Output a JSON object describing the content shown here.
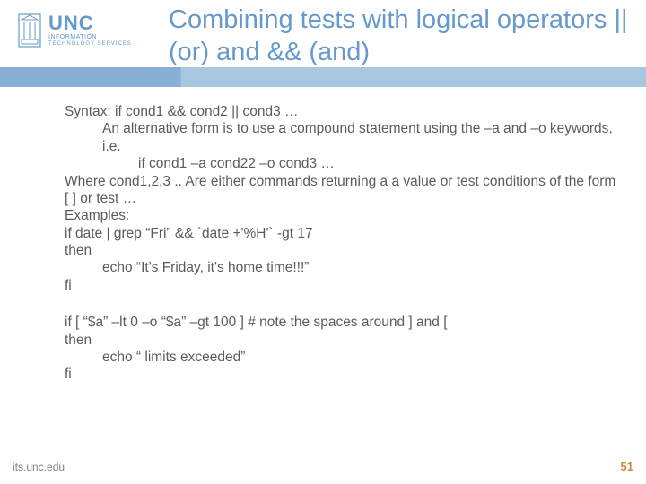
{
  "logo": {
    "unc": "UNC",
    "line1": "INFORMATION",
    "line2": "TECHNOLOGY SERVICES"
  },
  "title": "Combining tests with logical operators  || (or) and && (and)",
  "body": {
    "l1": "Syntax: if  cond1  && cond2  ||  cond3 …",
    "l2": "An alternative form is to use a compound statement using the –a and –o keywords, i.e.",
    "l3": "if cond1 –a cond22 –o cond3 …",
    "l4": "Where cond1,2,3 .. Are either commands returning a a value or test conditions of the form [  ]  or test …",
    "l5": "Examples:",
    "l6": "if  date | grep “Fri”  &&  `date +'%H'` -gt 17",
    "l7": "then",
    "l8": "echo “It's Friday, it's home time!!!”",
    "l9": "fi",
    "l10": "if [ “$a” –lt 0 –o “$a” –gt 100 ]      # note the spaces around ] and [",
    "l11": "then",
    "l12": "echo “ limits exceeded”",
    "l13": "fi"
  },
  "footer": {
    "left": "its.unc.edu",
    "right": "51"
  }
}
